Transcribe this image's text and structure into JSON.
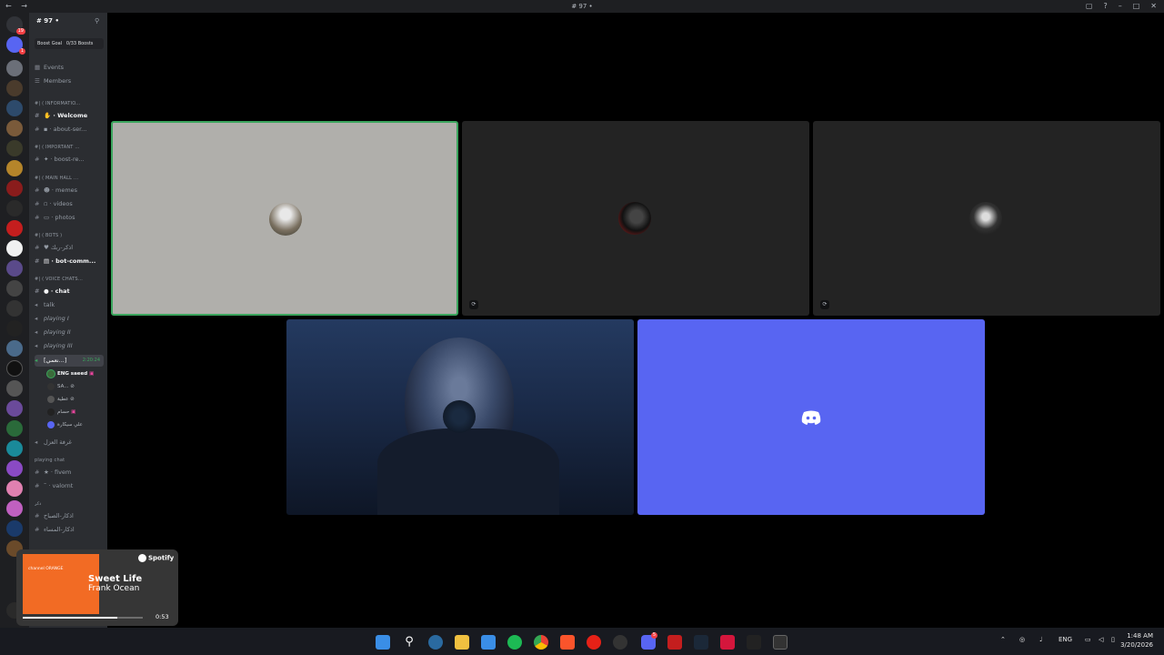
{
  "window": {
    "title": "# 97 •",
    "nav": "← →"
  },
  "server": {
    "name": "# 97 •",
    "boost_label": "Boost Goal",
    "boost_count": "0/33 Boosts",
    "rail_badges": [
      "19",
      "1"
    ]
  },
  "sidebar": {
    "events": "Events",
    "members": "Members",
    "categories": [
      "( INFORMATIO...",
      "( IMPORTANT ...",
      "( MAIN HALL ...",
      "( BOTS )",
      "( VOICE CHATS...",
      "playing chat",
      "ذكر"
    ],
    "channels": {
      "welcome": "Welcome",
      "about": "about-ser...",
      "boost": "boost-re...",
      "memes": "memes",
      "videos": "videos",
      "photos": "photos",
      "adhkar": "اذكر-ربك",
      "botcomm": "bot-comm...",
      "chat": "chat",
      "talk": "talk",
      "playing1": "playing I",
      "playing2": "playing II",
      "playing3": "playing III",
      "active_voice": "[نعمي...]",
      "active_time": "2:20:24",
      "isolation": "غرفة العزل",
      "fivem": "fivem",
      "valornt": "valornt",
      "morning": "اذكار-الصباح",
      "evening": "اذكار-المساء"
    },
    "voice_users": [
      "ENG saeed",
      "SA...",
      "عطية",
      "حسام",
      "علي سيكارة"
    ]
  },
  "spotify": {
    "brand": "Spotify",
    "song": "Sweet Life",
    "artist": "Frank Ocean",
    "time": "0:53",
    "progress": 0.79,
    "album_text": "channel ORANGE"
  },
  "taskbar": {
    "language": "ENG",
    "time": "1:48 AM",
    "date": "3/20/2026",
    "discord_badge": "5"
  },
  "colors": {
    "blurple": "#5865f2",
    "speaking": "#3ba55d",
    "spotify_green": "#1db954"
  }
}
